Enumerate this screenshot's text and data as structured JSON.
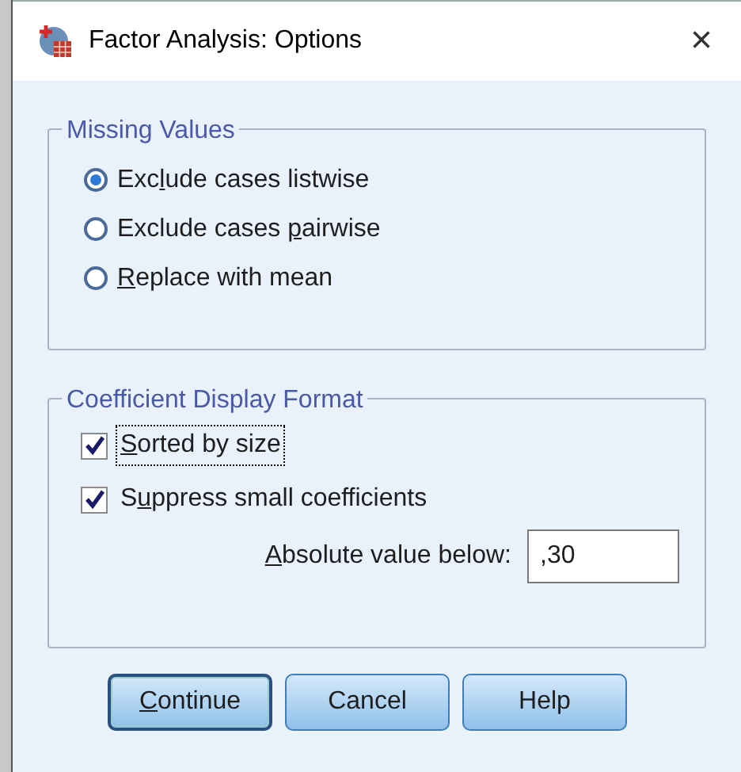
{
  "window": {
    "title": "Factor Analysis: Options",
    "close": "×"
  },
  "missing_values": {
    "title": "Missing Values",
    "options": [
      {
        "prefix": "Exc",
        "key": "l",
        "suffix": "ude cases listwise",
        "selected": true
      },
      {
        "prefix": "Exclude cases ",
        "key": "p",
        "suffix": "airwise",
        "selected": false
      },
      {
        "key": "R",
        "suffix": "eplace with mean",
        "selected": false
      }
    ]
  },
  "coefficient_format": {
    "title": "Coefficient Display Format",
    "checkboxes": [
      {
        "key": "S",
        "suffix": "orted by size",
        "checked": true,
        "focused": true
      },
      {
        "prefix": "S",
        "key": "u",
        "suffix": "ppress small coefficients",
        "checked": true,
        "focused": false
      }
    ],
    "absolute": {
      "key": "A",
      "suffix": "bsolute value below:",
      "value": ",30"
    }
  },
  "buttons": [
    {
      "key": "C",
      "suffix": "ontinue",
      "default": true
    },
    {
      "suffix": "Cancel",
      "default": false
    },
    {
      "suffix": "Help",
      "default": false
    }
  ]
}
